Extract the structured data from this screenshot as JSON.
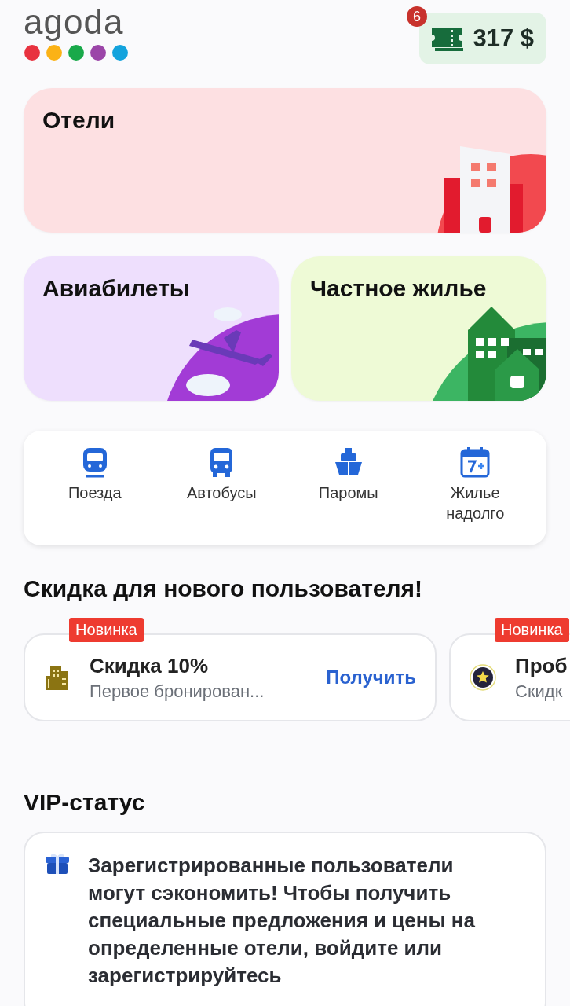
{
  "header": {
    "logo": "agoda",
    "wallet": {
      "badge": "6",
      "amount": "317 $"
    }
  },
  "categories": [
    {
      "kind": "hotel",
      "label": "Отели"
    },
    {
      "kind": "flight",
      "label": "Авиабилеты"
    },
    {
      "kind": "home",
      "label": "Частное жилье"
    }
  ],
  "transport": [
    {
      "kind": "train",
      "label": "Поезда"
    },
    {
      "kind": "bus",
      "label": "Автобусы"
    },
    {
      "kind": "ferry",
      "label": "Паромы"
    },
    {
      "kind": "calendar",
      "label": "Жилье надолго"
    }
  ],
  "promo_section": {
    "title": "Скидка для нового пользователя!",
    "cards": [
      {
        "kind": "building",
        "tag": "Новинка",
        "title": "Скидка 10%",
        "subtitle": "Первое бронирован...",
        "action": "Получить"
      },
      {
        "kind": "star",
        "tag": "Новинка",
        "title": "Проб",
        "subtitle": "Скидк"
      }
    ]
  },
  "vip": {
    "title": "VIP-статус",
    "message": "Зарегистрированные пользователи могут сэкономить! Чтобы получить специальные предложения и цены на определенные отели, войдите или зарегистрируйтесь"
  }
}
